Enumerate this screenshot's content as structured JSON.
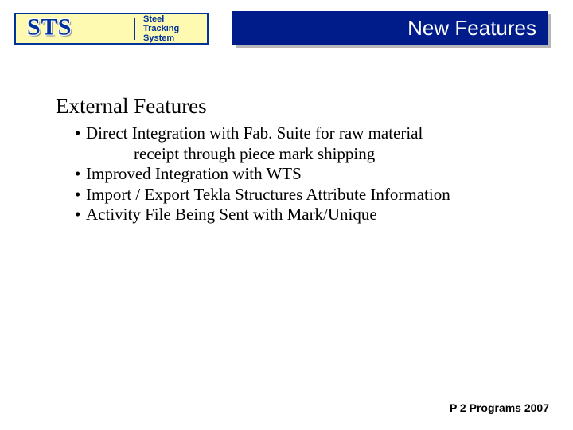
{
  "logo": {
    "abbr": "STS",
    "line1": "Steel",
    "line2": "Tracking",
    "line3": "System"
  },
  "title": "New Features",
  "subtitle": "External Features",
  "bullets": [
    {
      "text": "Direct Integration with Fab. Suite for raw material",
      "cont": "receipt through piece mark shipping"
    },
    {
      "text": "Improved Integration with WTS"
    },
    {
      "text": "Import / Export Tekla Structures Attribute Information"
    },
    {
      "text": "Activity File Being Sent with Mark/Unique"
    }
  ],
  "footer": "P 2 Programs 2007"
}
